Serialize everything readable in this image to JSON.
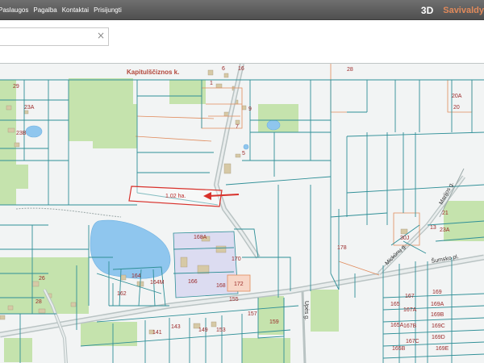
{
  "header": {
    "nav": [
      "Paslaugos",
      "Pagalba",
      "Kontaktai",
      "Prisijungti"
    ],
    "btn_3d": "3D",
    "title": "Savivaldy"
  },
  "search": {
    "value": "",
    "clear_glyph": "×"
  },
  "map": {
    "place_name": "Kapitulščiznos k.",
    "area_note": "1.02 ha.",
    "streets": [
      "Šumsko pl.",
      "Upės g.",
      "Marijos g.",
      "Mickūnų g."
    ],
    "parcels": [
      "29",
      "23A",
      "23B",
      "1",
      "16",
      "6",
      "28",
      "20A",
      "20",
      "9",
      "7",
      "5",
      "168A",
      "170",
      "172",
      "166",
      "164M",
      "164",
      "162",
      "168",
      "26",
      "28",
      "141",
      "143",
      "149",
      "153",
      "155",
      "157",
      "159",
      "178",
      "21",
      "23A",
      "30J",
      "13",
      "165",
      "167",
      "167A",
      "169",
      "169A",
      "169B",
      "165A",
      "167B",
      "169C",
      "169D",
      "167C",
      "165B",
      "169E"
    ]
  },
  "colors": {
    "parcel_line": "#2f8f97",
    "road": "#9aa7a7",
    "water": "#8fc6ee",
    "forest": "#bfe0a5",
    "arrow": "#d8312b",
    "accent": "#e08a5b"
  },
  "icons": {
    "clear": "close-icon",
    "arrow": "arrow-left-icon"
  }
}
